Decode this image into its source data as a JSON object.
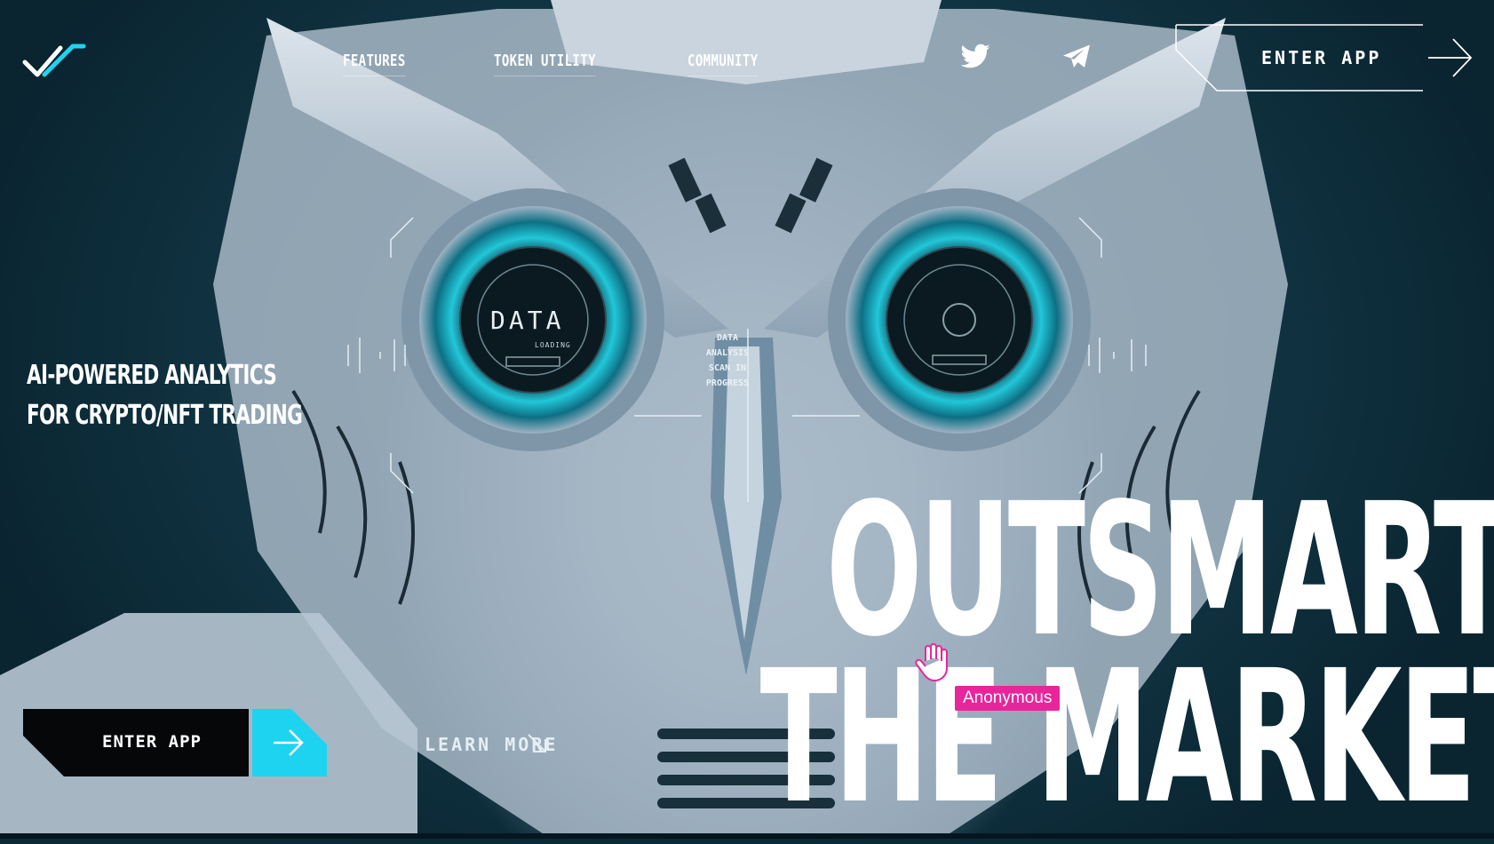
{
  "nav": {
    "links": [
      {
        "label": "FEATURES"
      },
      {
        "label": "TOKEN UTILITY"
      },
      {
        "label": "COMMUNITY"
      }
    ],
    "social": [
      "twitter-icon",
      "telegram-icon"
    ],
    "enter_app_label": "ENTER APP"
  },
  "hero": {
    "tagline_line1": "AI-POWERED ANALYTICS",
    "tagline_line2": "FOR CRYPTO/NFT TRADING",
    "headline_line1": "OUTSMART",
    "headline_line2": "THE MARKET",
    "eye_left_text": "DATA",
    "eye_left_sub": "LOADING",
    "hud_line1": "DATA",
    "hud_line2": "ANALYSIS",
    "hud_line3": "SCAN IN",
    "hud_line4": "PROGRESS"
  },
  "cta": {
    "enter_app_label": "ENTER APP",
    "learn_more_label": "LEARN MORE"
  },
  "cursor": {
    "user_label": "Anonymous"
  },
  "colors": {
    "accent_cyan": "#1ed3f0",
    "tag_pink": "#e8259b",
    "bg_dark": "#0b2a36"
  }
}
